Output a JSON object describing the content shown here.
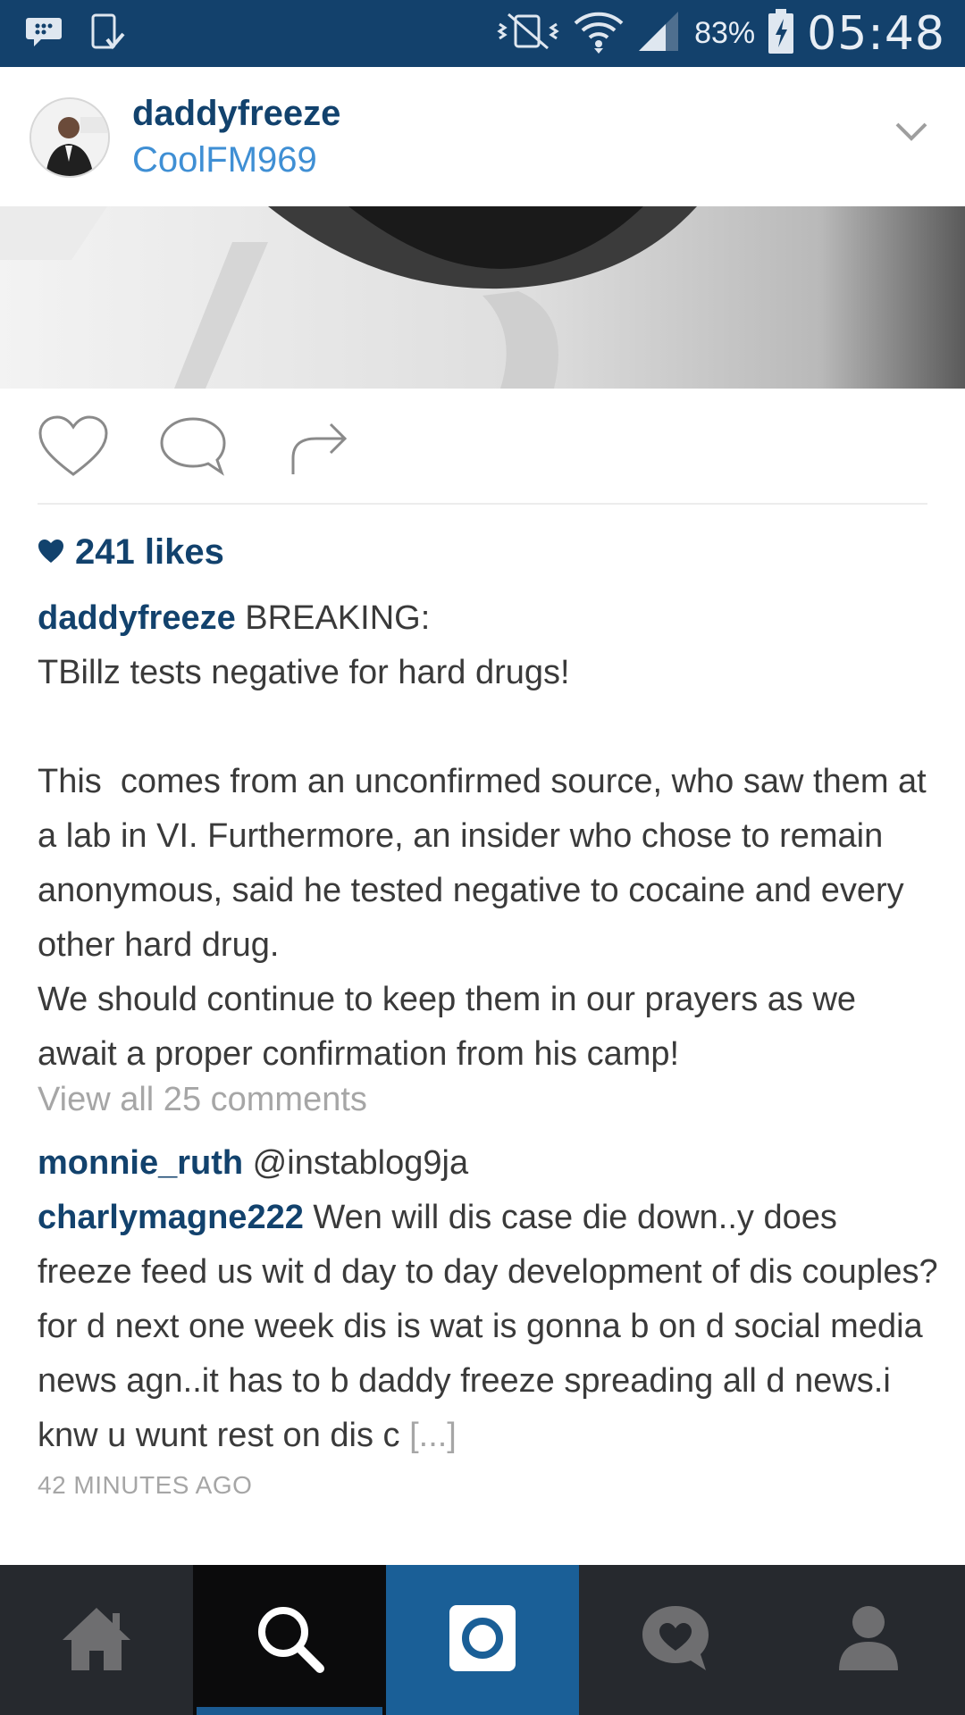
{
  "status_bar": {
    "battery_percent": "83%",
    "time": "05:48",
    "icons": [
      "bbm-icon",
      "download-icon",
      "vibrate-icon",
      "wifi-icon",
      "signal-icon",
      "battery-charging-icon"
    ]
  },
  "post": {
    "username": "daddyfreeze",
    "subtitle": "CoolFM969",
    "likes": "241 likes",
    "caption_user": "daddyfreeze",
    "caption_text": " BREAKING:\nTBillz tests negative for hard drugs!\n\nThis  comes from an unconfirmed source, who saw them at a lab in VI. Furthermore, an insider who chose to remain anonymous, said he tested negative to cocaine and every other hard drug.\nWe should continue to keep them in our prayers as we await a proper confirmation from his camp!",
    "view_all": "View all 25 comments",
    "comments": [
      {
        "user": "monnie_ruth",
        "text": " @instablog9ja"
      },
      {
        "user": "charlymagne222",
        "text": " Wen will dis case die down..y does freeze feed us wit d day to day development of dis couples?for d next one week dis is wat is gonna b on d social media news agn..it has to b daddy freeze spreading all d news.i knw u wunt rest on dis c ",
        "more": "[...]"
      }
    ],
    "timestamp": "42 MINUTES AGO"
  },
  "nav": {
    "items": [
      "home",
      "search",
      "camera",
      "activity",
      "profile"
    ],
    "active": "search"
  },
  "colors": {
    "status_bar": "#13416c",
    "link": "#12426d",
    "subtitle": "#3f8fd4",
    "nav_bg": "#26292e",
    "nav_active": "#1a5f97"
  }
}
